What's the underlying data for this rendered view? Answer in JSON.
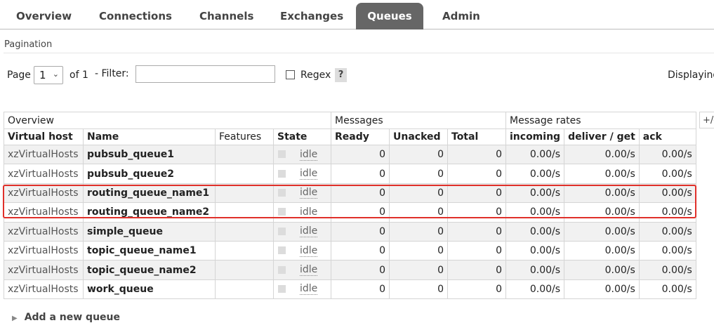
{
  "nav": {
    "tabs": [
      {
        "label": "Overview",
        "active": false
      },
      {
        "label": "Connections",
        "active": false
      },
      {
        "label": "Channels",
        "active": false
      },
      {
        "label": "Exchanges",
        "active": false
      },
      {
        "label": "Queues",
        "active": true
      },
      {
        "label": "Admin",
        "active": false
      }
    ]
  },
  "pagination": {
    "title": "Pagination",
    "page_label": "Page",
    "page_value": "1",
    "of_label": "of 1",
    "filter_label": "- Filter:",
    "filter_value": "",
    "regex_label": "Regex",
    "help_label": "?",
    "displaying_label": "Displaying"
  },
  "table": {
    "group_headers": [
      "Overview",
      "Messages",
      "Message rates"
    ],
    "columns": [
      "Virtual host",
      "Name",
      "Features",
      "State",
      "Ready",
      "Unacked",
      "Total",
      "incoming",
      "deliver / get",
      "ack"
    ],
    "plus_minus": "+/-",
    "rows": [
      {
        "vhost": "xzVirtualHosts",
        "name": "pubsub_queue1",
        "features": "",
        "state": "idle",
        "ready": "0",
        "unacked": "0",
        "total": "0",
        "incoming": "0.00/s",
        "deliver": "0.00/s",
        "ack": "0.00/s"
      },
      {
        "vhost": "xzVirtualHosts",
        "name": "pubsub_queue2",
        "features": "",
        "state": "idle",
        "ready": "0",
        "unacked": "0",
        "total": "0",
        "incoming": "0.00/s",
        "deliver": "0.00/s",
        "ack": "0.00/s"
      },
      {
        "vhost": "xzVirtualHosts",
        "name": "routing_queue_name1",
        "features": "",
        "state": "idle",
        "ready": "0",
        "unacked": "0",
        "total": "0",
        "incoming": "0.00/s",
        "deliver": "0.00/s",
        "ack": "0.00/s"
      },
      {
        "vhost": "xzVirtualHosts",
        "name": "routing_queue_name2",
        "features": "",
        "state": "idle",
        "ready": "0",
        "unacked": "0",
        "total": "0",
        "incoming": "0.00/s",
        "deliver": "0.00/s",
        "ack": "0.00/s"
      },
      {
        "vhost": "xzVirtualHosts",
        "name": "simple_queue",
        "features": "",
        "state": "idle",
        "ready": "0",
        "unacked": "0",
        "total": "0",
        "incoming": "0.00/s",
        "deliver": "0.00/s",
        "ack": "0.00/s"
      },
      {
        "vhost": "xzVirtualHosts",
        "name": "topic_queue_name1",
        "features": "",
        "state": "idle",
        "ready": "0",
        "unacked": "0",
        "total": "0",
        "incoming": "0.00/s",
        "deliver": "0.00/s",
        "ack": "0.00/s"
      },
      {
        "vhost": "xzVirtualHosts",
        "name": "topic_queue_name2",
        "features": "",
        "state": "idle",
        "ready": "0",
        "unacked": "0",
        "total": "0",
        "incoming": "0.00/s",
        "deliver": "0.00/s",
        "ack": "0.00/s"
      },
      {
        "vhost": "xzVirtualHosts",
        "name": "work_queue",
        "features": "",
        "state": "idle",
        "ready": "0",
        "unacked": "0",
        "total": "0",
        "incoming": "0.00/s",
        "deliver": "0.00/s",
        "ack": "0.00/s"
      }
    ]
  },
  "add_queue": {
    "label": "Add a new queue"
  },
  "colors": {
    "active_tab": "#666666",
    "highlight": "#e0302a",
    "row_alt": "#f1f1f1"
  },
  "icons": {
    "expand": "triangle-right-icon",
    "dropdown": "chevron-down-icon"
  }
}
